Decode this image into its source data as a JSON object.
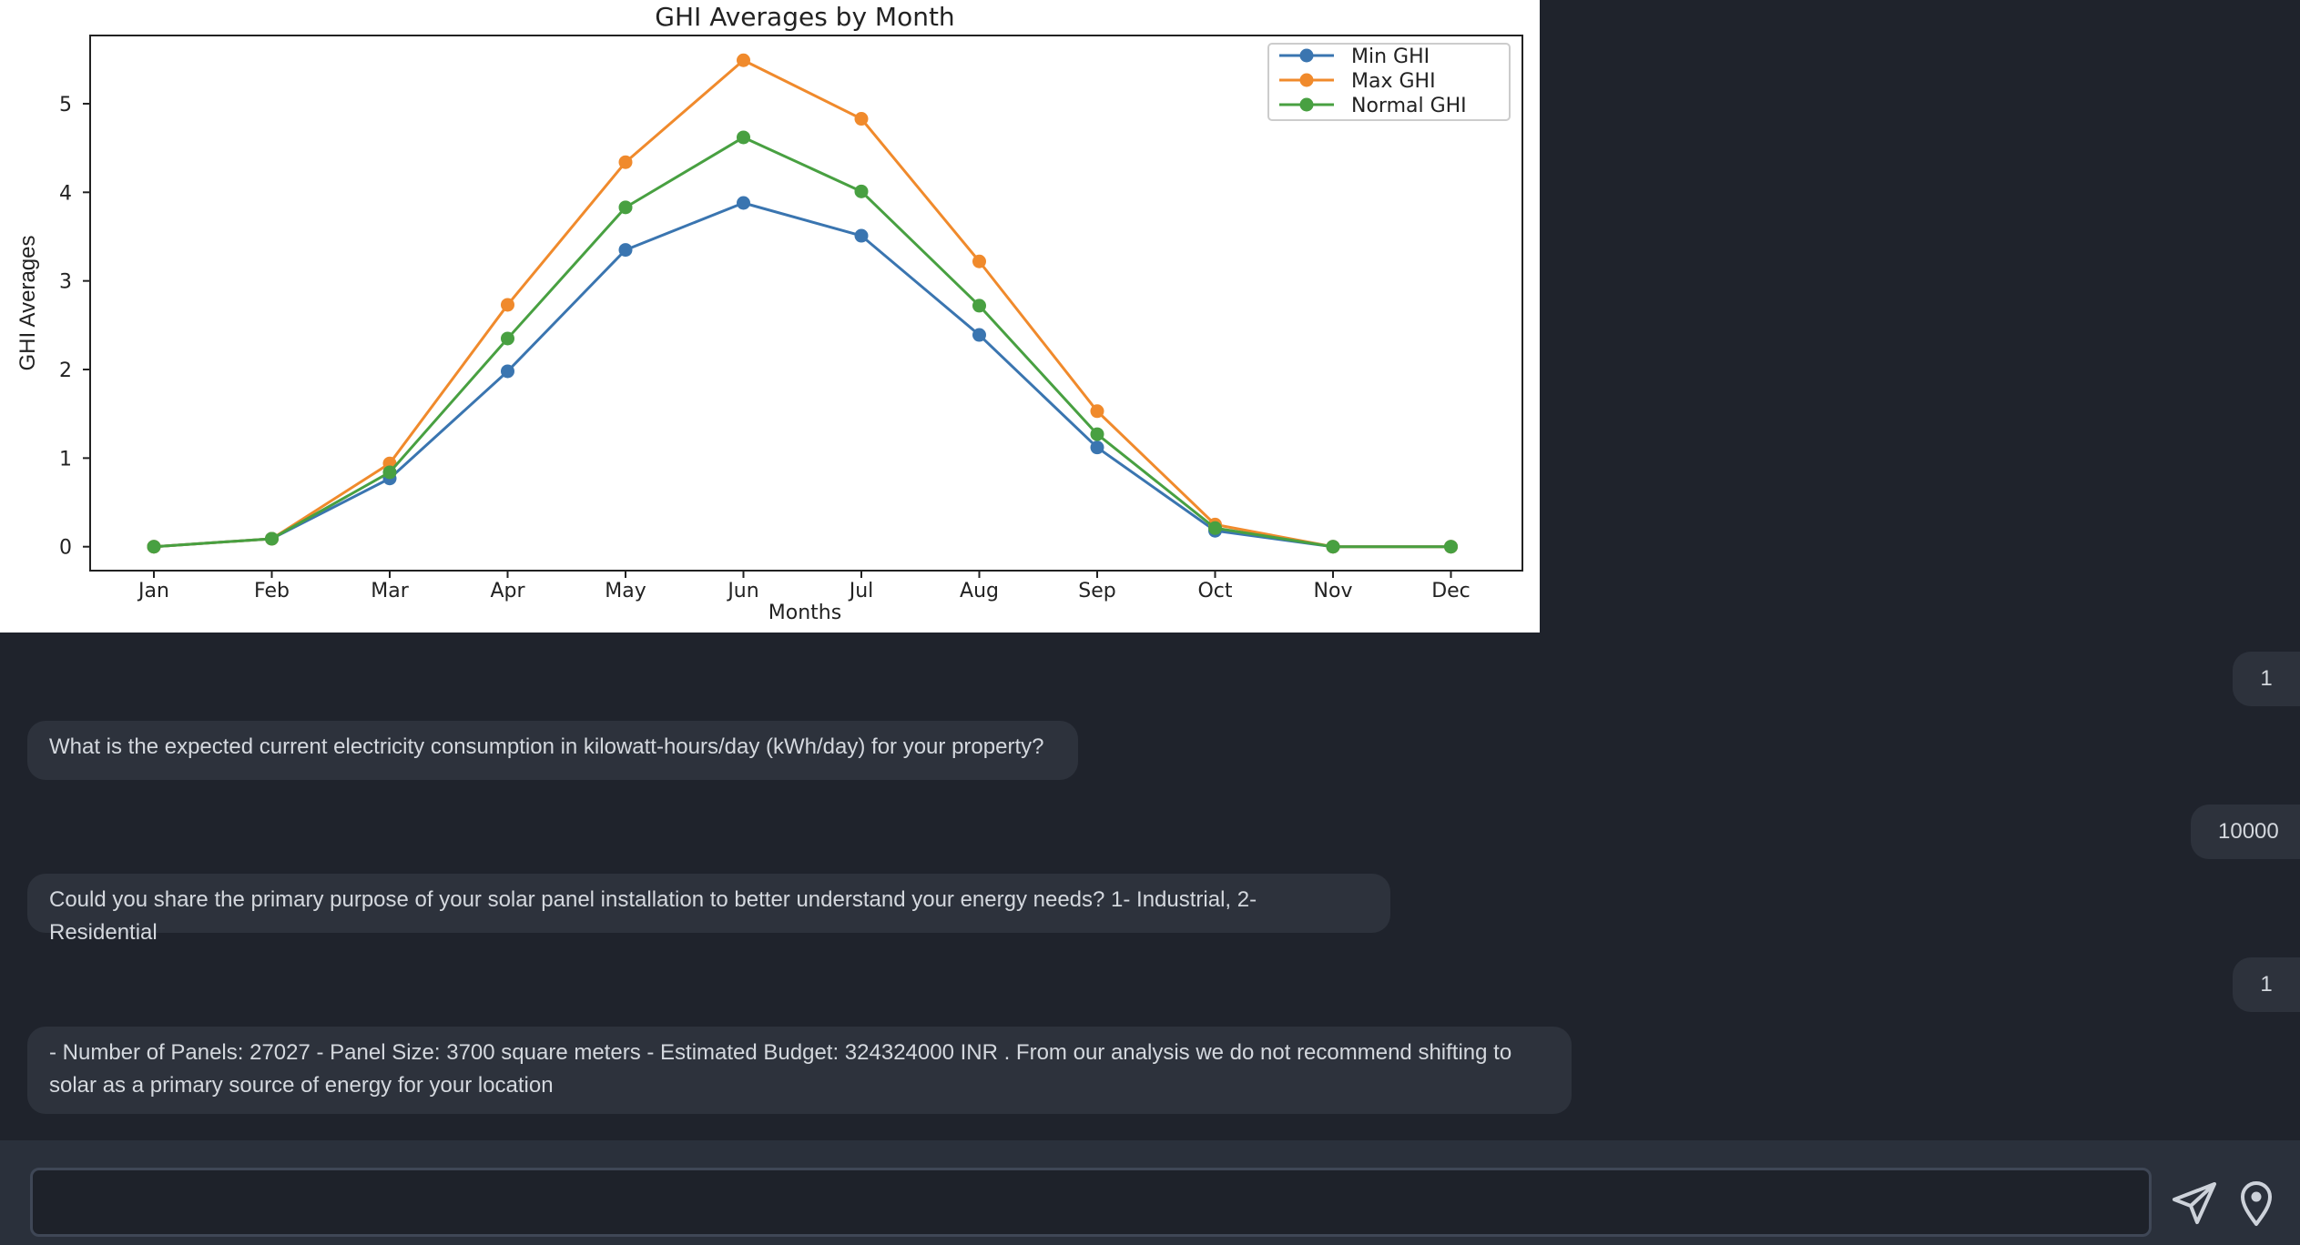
{
  "chart_data": {
    "type": "line",
    "title": "GHI Averages by Month",
    "xlabel": "Months",
    "ylabel": "GHI Averages",
    "categories": [
      "Jan",
      "Feb",
      "Mar",
      "Apr",
      "May",
      "Jun",
      "Jul",
      "Aug",
      "Sep",
      "Oct",
      "Nov",
      "Dec"
    ],
    "yticks": [
      "0",
      "1",
      "2",
      "3",
      "4",
      "5"
    ],
    "ylim": [
      -0.27,
      5.77
    ],
    "grid": false,
    "legend_position": "top-right",
    "series": [
      {
        "name": "Min GHI",
        "color": "#3a75b0",
        "values": [
          0,
          0.09,
          0.77,
          1.98,
          3.35,
          3.88,
          3.51,
          2.39,
          1.12,
          0.18,
          0,
          0
        ]
      },
      {
        "name": "Max GHI",
        "color": "#f08a2c",
        "values": [
          0,
          0.09,
          0.94,
          2.73,
          4.34,
          5.49,
          4.83,
          3.22,
          1.53,
          0.25,
          0,
          0
        ]
      },
      {
        "name": "Normal GHI",
        "color": "#48a041",
        "values": [
          0,
          0.09,
          0.84,
          2.35,
          3.83,
          4.62,
          4.01,
          2.72,
          1.27,
          0.21,
          0,
          0
        ]
      }
    ]
  },
  "messages": [
    {
      "role": "user",
      "text": "1"
    },
    {
      "role": "bot",
      "text": "What is the expected current electricity consumption in kilowatt-hours/day (kWh/day) for your property?"
    },
    {
      "role": "user",
      "text": "10000"
    },
    {
      "role": "bot",
      "text": "Could you share the primary purpose of your solar panel installation to better understand your energy needs? 1- Industrial, 2- Residential"
    },
    {
      "role": "user",
      "text": "1"
    },
    {
      "role": "bot",
      "text": "- Number of Panels: 27027 - Panel Size: 3700 square meters - Estimated Budget: 324324000 INR . From our analysis we do not recommend shifting to solar as a primary source of energy for your location"
    }
  ],
  "composer": {
    "input_value": "",
    "placeholder": "",
    "send_icon": "send-icon",
    "location_icon": "location-pin-icon"
  }
}
